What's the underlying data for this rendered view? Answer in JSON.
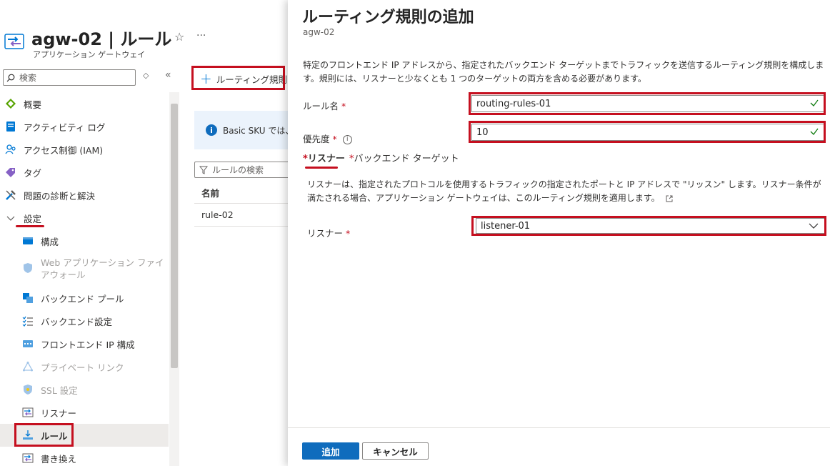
{
  "app": {
    "title": "agw-02 | ルール",
    "subtitle": "アプリケーション ゲートウェイ",
    "favorite_icon": "star-icon",
    "more_icon": "ellipsis-icon"
  },
  "sidebar": {
    "search_placeholder": "検索",
    "items": [
      {
        "label": "概要",
        "icon": "overview-icon",
        "color": "#57a300"
      },
      {
        "label": "アクティビティ ログ",
        "icon": "activity-log-icon",
        "color": "#0078d4"
      },
      {
        "label": "アクセス制御 (IAM)",
        "icon": "iam-icon",
        "color": "#0078d4"
      },
      {
        "label": "タグ",
        "icon": "tag-icon",
        "color": "#8661c5"
      },
      {
        "label": "問題の診断と解決",
        "icon": "diagnose-icon",
        "color": "#0078d4"
      },
      {
        "label": "設定",
        "icon": "chevron-down-icon"
      },
      {
        "label": "構成",
        "icon": "configuration-icon",
        "color": "#0078d4"
      },
      {
        "label": "Web アプリケーション ファイアウォール",
        "label_line1": "Web アプリケーション ファイ",
        "label_line2": "アウォール",
        "icon": "waf-icon",
        "color": "#a0c4e8"
      },
      {
        "label": "バックエンド プール",
        "icon": "backend-pool-icon",
        "color": "#0078d4"
      },
      {
        "label": "バックエンド設定",
        "icon": "backend-settings-icon",
        "color": "#0078d4"
      },
      {
        "label": "フロントエンド IP 構成",
        "icon": "frontend-ip-icon",
        "color": "#0078d4"
      },
      {
        "label": "プライベート リンク",
        "icon": "private-link-icon",
        "color": "#a0c4e8"
      },
      {
        "label": "SSL 設定",
        "icon": "ssl-icon",
        "color": "#a0c4e8"
      },
      {
        "label": "リスナー",
        "icon": "listener-icon",
        "color": "#0078d4"
      },
      {
        "label": "ルール",
        "icon": "rules-icon",
        "color": "#0078d4"
      },
      {
        "label": "書き換え",
        "icon": "rewrite-icon",
        "color": "#0078d4"
      }
    ]
  },
  "main": {
    "add_rule_button": "ルーティング規則",
    "info_text": "Basic SKU では、",
    "filter_placeholder": "ルールの検索",
    "column_name": "名前",
    "rows": [
      "rule-02"
    ]
  },
  "panel": {
    "title": "ルーティング規則の追加",
    "subtitle": "agw-02",
    "description": "特定のフロントエンド IP アドレスから、指定されたバックエンド ターゲットまでトラフィックを送信するルーティング規則を構成します。規則には、リスナーと少なくとも 1 つのターゲットの両方を含める必要があります。",
    "rule_name_label": "ルール名",
    "rule_name_value": "routing-rules-01",
    "priority_label": "優先度",
    "priority_value": "10",
    "tabs": [
      {
        "label": "リスナー",
        "active": true
      },
      {
        "label": "バックエンド ターゲット",
        "active": false
      }
    ],
    "listener_description": "リスナーは、指定されたプロトコルを使用するトラフィックの指定されたポートと IP アドレスで \"リッスン\" します。リスナー条件が満たされる場合、アプリケーション ゲートウェイは、このルーティング規則を適用します。",
    "listener_label": "リスナー",
    "listener_value": "listener-01",
    "add_button": "追加",
    "cancel_button": "キャンセル"
  },
  "colors": {
    "accent": "#0f6cbd",
    "highlight_red": "#c50f1f",
    "valid_check": "#107c10"
  }
}
